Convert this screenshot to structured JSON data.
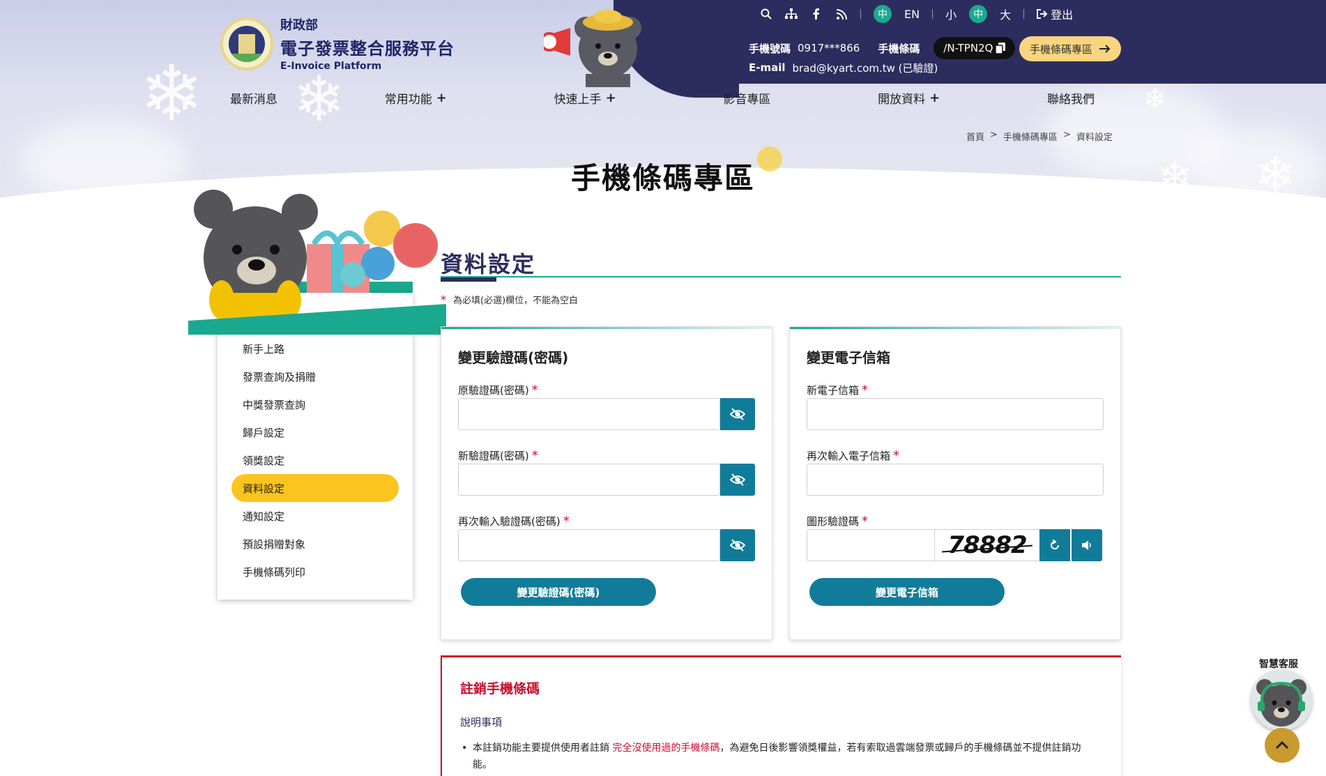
{
  "brand": {
    "dept": "財政部",
    "title": "電子發票整合服務平台",
    "title_en": "E-Invoice Platform"
  },
  "utility": {
    "icons": [
      "search-icon",
      "sitemap-icon",
      "facebook-icon",
      "rss-icon"
    ],
    "lang_zh": "中",
    "lang_en": "EN",
    "font_small": "小",
    "font_medium": "中",
    "font_large": "大",
    "logout": "登出"
  },
  "user": {
    "phone_label": "手機號碼",
    "phone_value": "0917***866",
    "carrier_label": "手機條碼",
    "carrier_value": "/N-TPN2Q",
    "email_label": "E-mail",
    "email_value": "brad@kyart.com.tw (已驗證)",
    "zone_button": "手機條碼專區"
  },
  "nav": [
    {
      "label": "最新消息",
      "expandable": false
    },
    {
      "label": "常用功能",
      "expandable": true
    },
    {
      "label": "快速上手",
      "expandable": true
    },
    {
      "label": "影音專區",
      "expandable": false
    },
    {
      "label": "開放資料",
      "expandable": true
    },
    {
      "label": "聯絡我們",
      "expandable": false
    }
  ],
  "breadcrumb": [
    "首頁",
    ">",
    "手機條碼專區",
    ">",
    "資料設定"
  ],
  "page_heading": "手機條碼專區",
  "sidebar": {
    "items": [
      "新手上路",
      "發票查詢及捐贈",
      "中獎發票查詢",
      "歸戶設定",
      "領獎設定",
      "資料設定",
      "通知設定",
      "預設捐贈對象",
      "手機條碼列印"
    ],
    "active_index": 5
  },
  "section": {
    "title": "資料設定",
    "required_star": "*",
    "required_note": "為必填(必選)欄位，不能為空白"
  },
  "password_panel": {
    "title": "變更驗證碼(密碼)",
    "old_label": "原驗證碼(密碼)",
    "new_label": "新驗證碼(密碼)",
    "confirm_label": "再次輸入驗證碼(密碼)",
    "submit": "變更驗證碼(密碼)"
  },
  "email_panel": {
    "title": "變更電子信箱",
    "new_label": "新電子信箱",
    "confirm_label": "再次輸入電子信箱",
    "captcha_label": "圖形驗證碼",
    "captcha_text": "78882",
    "submit": "變更電子信箱"
  },
  "req_mark": "*",
  "cancel_panel": {
    "title": "註銷手機條碼",
    "subtitle": "說明事項",
    "text_before": "本註銷功能主要提供使用者註銷 ",
    "text_highlight": "完全沒使用過的手機條碼",
    "text_after": "，為避免日後影響領獎權益，若有索取過雲端發票或歸戶的手機條碼並不提供註銷功能。"
  },
  "floating": {
    "bot_label": "智慧客服"
  },
  "colors": {
    "navy": "#2c2d5e",
    "teal": "#1aa98f",
    "button": "#117c99",
    "active": "#fdc31f",
    "danger": "#c8102e"
  }
}
